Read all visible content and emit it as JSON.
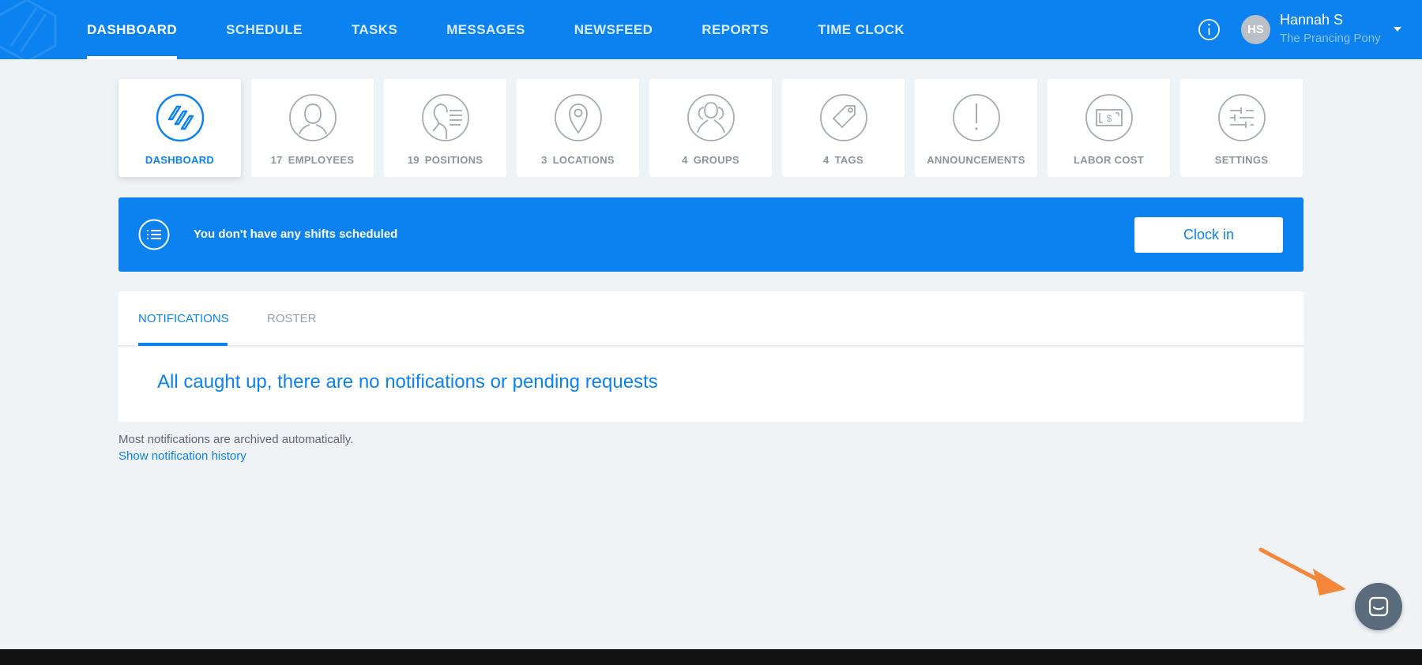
{
  "nav": {
    "items": [
      {
        "label": "DASHBOARD",
        "active": true
      },
      {
        "label": "SCHEDULE",
        "active": false
      },
      {
        "label": "TASKS",
        "active": false
      },
      {
        "label": "MESSAGES",
        "active": false
      },
      {
        "label": "NEWSFEED",
        "active": false
      },
      {
        "label": "REPORTS",
        "active": false
      },
      {
        "label": "TIME CLOCK",
        "active": false
      }
    ],
    "info_icon": "info-icon"
  },
  "user": {
    "initials": "HS",
    "name": "Hannah S",
    "org": "The Prancing Pony"
  },
  "tiles": [
    {
      "id": "dashboard",
      "count": "",
      "label": "DASHBOARD",
      "icon": "dashboard-icon",
      "active": true
    },
    {
      "id": "employees",
      "count": "17",
      "label": "EMPLOYEES",
      "icon": "person-icon",
      "active": false
    },
    {
      "id": "positions",
      "count": "19",
      "label": "POSITIONS",
      "icon": "position-icon",
      "active": false
    },
    {
      "id": "locations",
      "count": "3",
      "label": "LOCATIONS",
      "icon": "map-pin-icon",
      "active": false
    },
    {
      "id": "groups",
      "count": "4",
      "label": "GROUPS",
      "icon": "group-icon",
      "active": false
    },
    {
      "id": "tags",
      "count": "4",
      "label": "TAGS",
      "icon": "tag-icon",
      "active": false
    },
    {
      "id": "announcements",
      "count": "",
      "label": "ANNOUNCEMENTS",
      "icon": "exclamation-icon",
      "active": false
    },
    {
      "id": "labor-cost",
      "count": "",
      "label": "LABOR COST",
      "icon": "money-icon",
      "active": false
    },
    {
      "id": "settings",
      "count": "",
      "label": "SETTINGS",
      "icon": "sliders-icon",
      "active": false
    }
  ],
  "banner": {
    "message": "You don't have any shifts scheduled",
    "button_label": "Clock in"
  },
  "tabs": [
    {
      "label": "NOTIFICATIONS",
      "active": true
    },
    {
      "label": "ROSTER",
      "active": false
    }
  ],
  "notifications": {
    "empty_message": "All caught up, there are no notifications or pending requests",
    "archive_note": "Most notifications are archived automatically.",
    "history_link": "Show notification history"
  },
  "colors": {
    "brand": "#0b82f0",
    "background": "#f0f3f6",
    "arrow": "#f5873a",
    "chat": "#5a6b7e"
  }
}
